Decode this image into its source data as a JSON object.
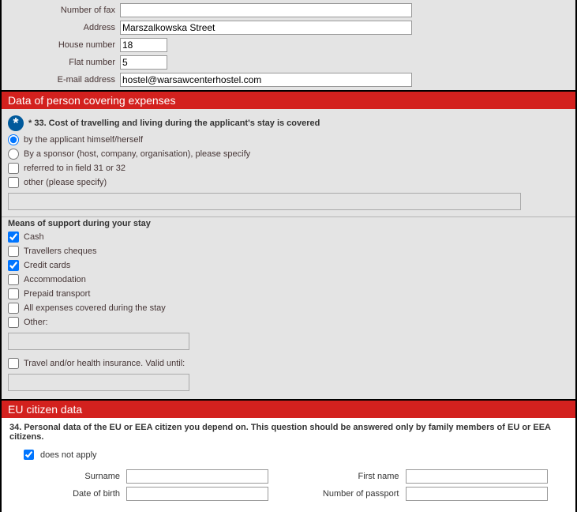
{
  "contact": {
    "fax_label": "Number of fax",
    "fax_value": "",
    "address_label": "Address",
    "address_value": "Marszalkowska Street",
    "house_label": "House number",
    "house_value": "18",
    "flat_label": "Flat number",
    "flat_value": "5",
    "email_label": "E-mail address",
    "email_value": "hostel@warsawcenterhostel.com"
  },
  "expenses": {
    "section_title": "Data of person covering expenses",
    "q33": "* 33. Cost of travelling and living during the applicant's stay is covered",
    "opt_self": "by the applicant himself/herself",
    "opt_sponsor": "By a sponsor (host, company, organisation), please specify",
    "opt_ref": "referred to in field 31 or 32",
    "opt_other": "other (please specify)",
    "other_value": ""
  },
  "means": {
    "heading": "Means of support during your stay",
    "cash": "Cash",
    "travellers": "Travellers cheques",
    "credit": "Credit cards",
    "accom": "Accommodation",
    "prepaid": "Prepaid transport",
    "allexp": "All expenses covered during the stay",
    "other": "Other:",
    "other_value": "",
    "insurance": "Travel and/or health insurance. Valid until:",
    "insurance_value": ""
  },
  "eu": {
    "section_title": "EU citizen data",
    "q34": "34. Personal data of the EU or EEA citizen you depend on. This question should be answered only by family members of EU or EEA citizens.",
    "not_apply": "does not apply",
    "surname_label": "Surname",
    "surname_value": "",
    "first_label": "First name",
    "first_value": "",
    "dob_label": "Date of birth",
    "dob_value": "",
    "passport_label": "Number of passport",
    "passport_value": ""
  }
}
